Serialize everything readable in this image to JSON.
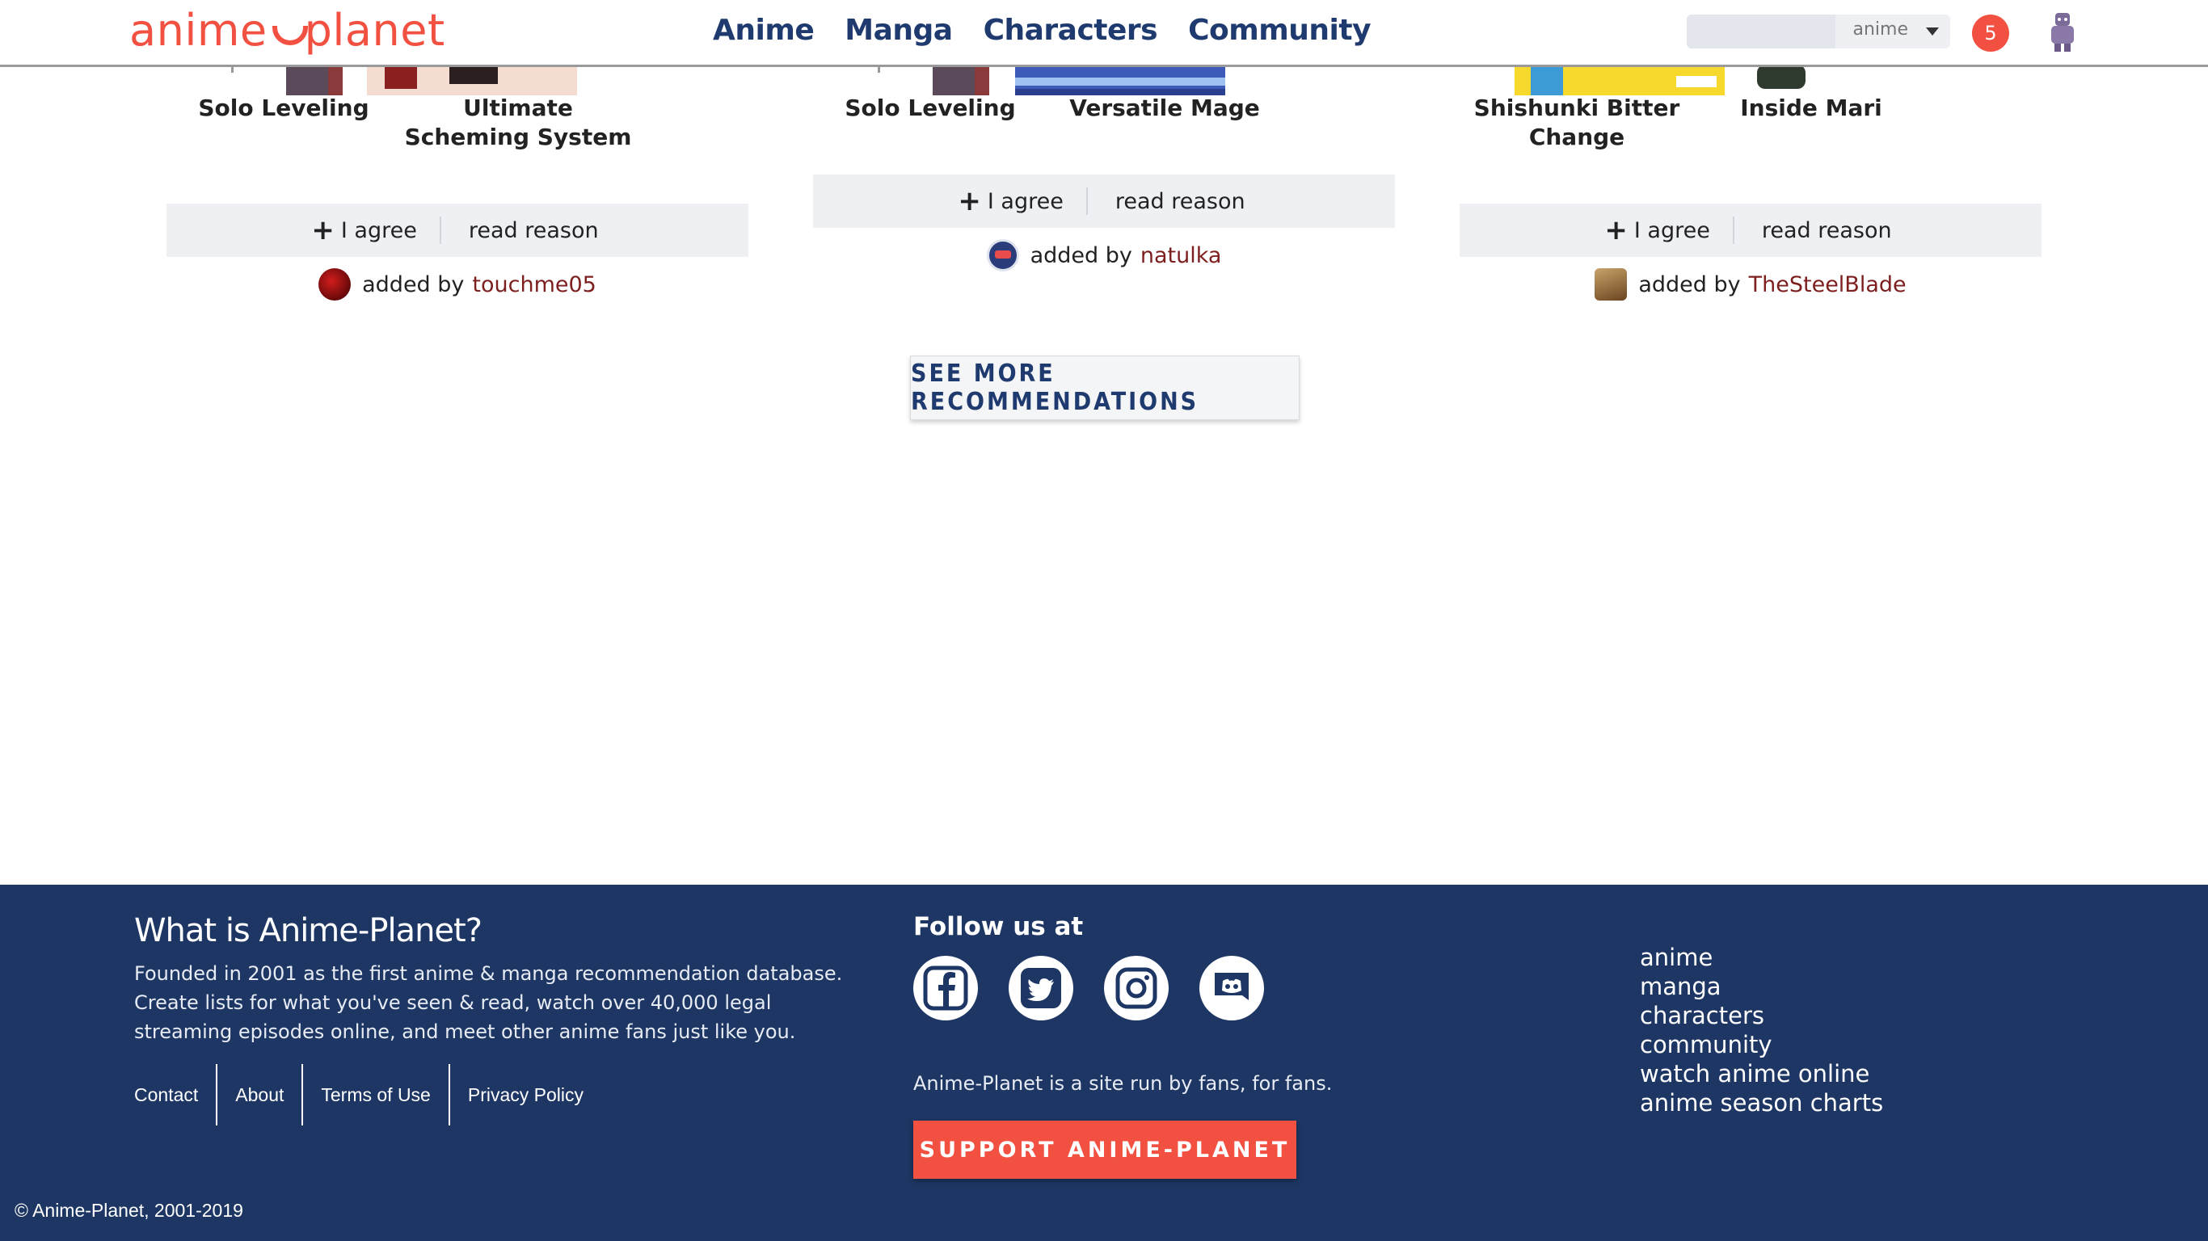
{
  "header": {
    "logo_left": "anime",
    "logo_right": "planet",
    "nav": [
      "Anime",
      "Manga",
      "Characters",
      "Community"
    ],
    "search_type": "anime",
    "notification_count": "5"
  },
  "recommendations": [
    {
      "titles": [
        "Solo Leveling",
        "Ultimate Scheming System"
      ],
      "agree_label": "I agree",
      "reason_label": "read reason",
      "added_prefix": "added by",
      "user": "touchme05"
    },
    {
      "titles": [
        "Solo Leveling",
        "Versatile Mage"
      ],
      "agree_label": "I agree",
      "reason_label": "read reason",
      "added_prefix": "added by",
      "user": "natulka"
    },
    {
      "titles": [
        "Shishunki Bitter Change",
        "Inside Mari"
      ],
      "agree_label": "I agree",
      "reason_label": "read reason",
      "added_prefix": "added by",
      "user": "TheSteelBlade"
    }
  ],
  "see_more_label": "SEE MORE RECOMMENDATIONS",
  "footer": {
    "about_title": "What is Anime-Planet?",
    "about_text": "Founded in 2001 as the first anime & manga recommendation database. Create lists for what you've seen & read, watch over 40,000 legal streaming episodes online, and meet other anime fans just like you.",
    "links": [
      "Contact",
      "About",
      "Terms of Use",
      "Privacy Policy"
    ],
    "follow_title": "Follow us at",
    "socials": [
      "facebook-icon",
      "twitter-icon",
      "instagram-icon",
      "discord-icon"
    ],
    "tagline": "Anime-Planet is a site run by fans, for fans.",
    "support_label": "SUPPORT ANIME-PLANET",
    "nav": [
      "anime",
      "manga",
      "characters",
      "community",
      "watch anime online",
      "anime season charts"
    ],
    "copyright": "© Anime-Planet, 2001-2019"
  },
  "colors": {
    "brand": "#f25041",
    "nav_blue": "#1f3a6e",
    "footer_bg": "#1d3663",
    "username": "#7d1f1f"
  }
}
